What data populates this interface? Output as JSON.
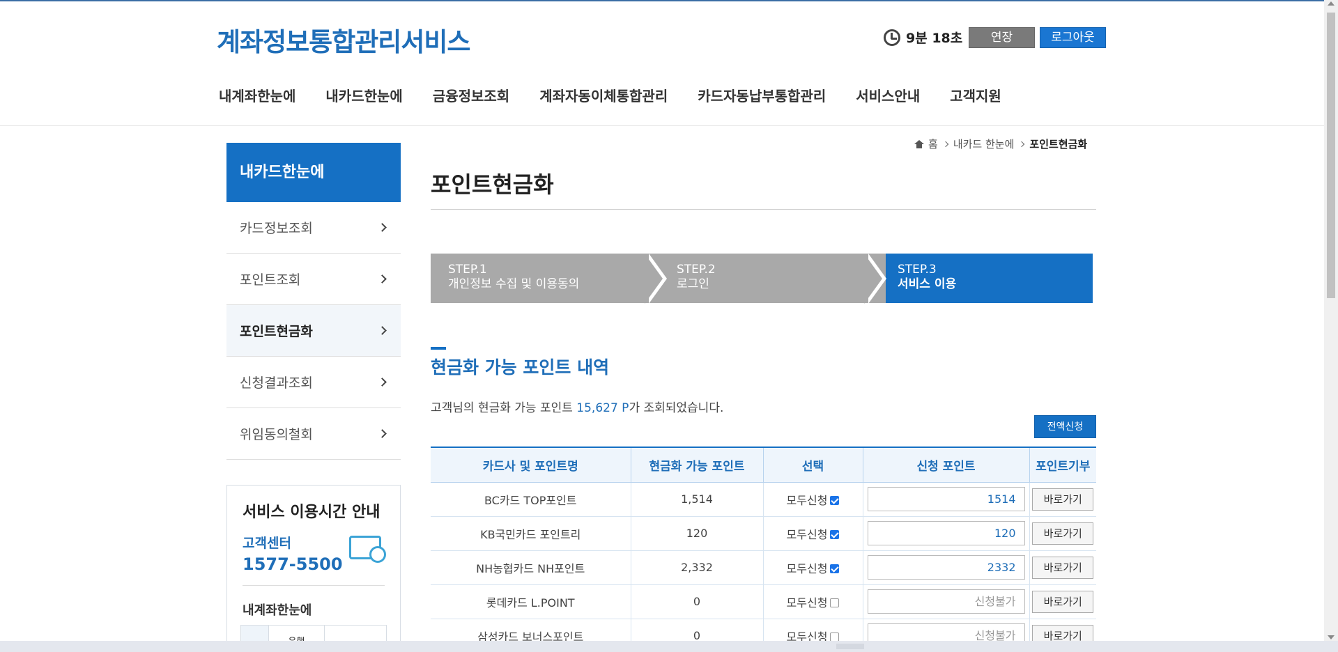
{
  "header": {
    "logo": "계좌정보통합관리서비스",
    "timer": "9분 18초",
    "extend_label": "연장",
    "logout_label": "로그아웃",
    "nav": [
      "내계좌한눈에",
      "내카드한눈에",
      "금융정보조회",
      "계좌자동이체통합관리",
      "카드자동납부통합관리",
      "서비스안내",
      "고객지원"
    ]
  },
  "sidebar": {
    "title": "내카드한눈에",
    "items": [
      {
        "label": "카드정보조회",
        "active": false
      },
      {
        "label": "포인트조회",
        "active": false
      },
      {
        "label": "포인트현금화",
        "active": true
      },
      {
        "label": "신청결과조회",
        "active": false
      },
      {
        "label": "위임동의철회",
        "active": false
      }
    ],
    "service_box": {
      "title": "서비스 이용시간 안내",
      "center_label": "고객센터",
      "phone": "1577-5500",
      "sub_title": "내계좌한눈에",
      "mini_header": "은행"
    }
  },
  "breadcrumb": {
    "home": "홈",
    "level1": "내카드 한눈에",
    "current": "포인트현금화"
  },
  "main": {
    "title": "포인트현금화",
    "steps": [
      {
        "num": "STEP.1",
        "label": "개인정보 수집 및 이용동의"
      },
      {
        "num": "STEP.2",
        "label": "로그인"
      },
      {
        "num": "STEP.3",
        "label": "서비스 이용"
      }
    ],
    "section_title": "현금화 가능 포인트 내역",
    "summary_prefix": "고객님의 현금화 가능 포인트 ",
    "summary_value": "15,627 P",
    "summary_suffix": "가 조회되었습니다.",
    "apply_all_label": "전액신청"
  },
  "table": {
    "headers": [
      "카드사 및 포인트명",
      "현금화 가능 포인트",
      "선택",
      "신청 포인트",
      "포인트기부"
    ],
    "rows": [
      {
        "name": "BC카드 TOP포인트",
        "points": "1,514",
        "select_label": "모두신청",
        "checked": true,
        "value": "1514",
        "placeholder": "",
        "donate": "바로가기"
      },
      {
        "name": "KB국민카드 포인트리",
        "points": "120",
        "select_label": "모두신청",
        "checked": true,
        "value": "120",
        "placeholder": "",
        "donate": "바로가기"
      },
      {
        "name": "NH농협카드 NH포인트",
        "points": "2,332",
        "select_label": "모두신청",
        "checked": true,
        "value": "2332",
        "placeholder": "",
        "donate": "바로가기"
      },
      {
        "name": "롯데카드 L.POINT",
        "points": "0",
        "select_label": "모두신청",
        "checked": false,
        "value": "",
        "placeholder": "신청불가",
        "donate": "바로가기"
      },
      {
        "name": "삼성카드 보너스포인트",
        "points": "0",
        "select_label": "모두신청",
        "checked": false,
        "value": "",
        "placeholder": "신청불가",
        "donate": "바로가기"
      }
    ]
  },
  "colors": {
    "brand_blue": "#1570c4",
    "step_gray": "#a9a9a9",
    "extend_gray": "#7a7a7a"
  }
}
